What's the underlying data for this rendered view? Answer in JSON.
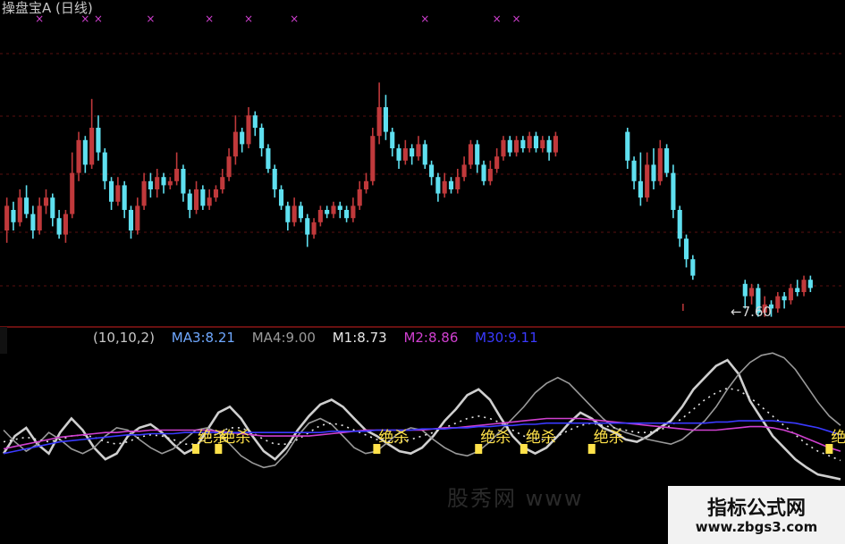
{
  "title": "操盘宝A (日线)",
  "legend": [
    {
      "text": "(10,10,2)",
      "color": "#c8c8c8"
    },
    {
      "text": "MA3:8.21",
      "color": "#6fa8ff"
    },
    {
      "text": "MA4:9.00",
      "color": "#9a9a9a"
    },
    {
      "text": "M1:8.73",
      "color": "#e6e6e6"
    },
    {
      "text": "M2:8.86",
      "color": "#d040d0"
    },
    {
      "text": "M30:9.11",
      "color": "#3a3aff"
    }
  ],
  "price_label": "←7.60",
  "signal_label": "绝杀",
  "ghost_text": "股秀网   www",
  "watermark": {
    "title": "指标公式网",
    "url": "www.zbgs3.com"
  },
  "colors": {
    "up": "#c0393b",
    "down": "#5fe0f0",
    "grid": "#5a1010",
    "signal": "#ffe24a",
    "marker": "#d040d0"
  },
  "chart_data": [
    {
      "type": "candlestick",
      "title": "操盘宝A (日线)",
      "ylim": [
        7.0,
        13.5
      ],
      "annotations": [
        {
          "text": "←7.60",
          "y": 7.6
        }
      ],
      "candles": [
        [
          9.0,
          9.6,
          8.7,
          9.8
        ],
        [
          9.5,
          9.2,
          9.0,
          9.7
        ],
        [
          9.2,
          9.8,
          9.1,
          10.0
        ],
        [
          9.8,
          9.4,
          9.3,
          10.1
        ],
        [
          9.4,
          9.0,
          8.8,
          9.6
        ],
        [
          9.0,
          9.6,
          8.9,
          9.8
        ],
        [
          9.6,
          9.8,
          9.4,
          10.0
        ],
        [
          9.8,
          9.3,
          9.1,
          9.9
        ],
        [
          9.3,
          8.9,
          8.8,
          9.5
        ],
        [
          8.9,
          9.4,
          8.7,
          9.5
        ],
        [
          9.4,
          10.4,
          9.3,
          10.9
        ],
        [
          10.4,
          11.2,
          10.2,
          11.4
        ],
        [
          11.2,
          10.6,
          10.4,
          11.3
        ],
        [
          10.6,
          11.5,
          10.5,
          12.2
        ],
        [
          11.5,
          10.9,
          10.7,
          11.8
        ],
        [
          10.9,
          10.2,
          10.0,
          11.0
        ],
        [
          10.2,
          9.7,
          9.5,
          10.3
        ],
        [
          9.7,
          10.1,
          9.6,
          10.3
        ],
        [
          10.1,
          9.5,
          9.3,
          10.2
        ],
        [
          9.5,
          9.0,
          8.8,
          9.6
        ],
        [
          9.0,
          9.6,
          8.9,
          9.8
        ],
        [
          9.6,
          10.2,
          9.5,
          10.4
        ],
        [
          10.2,
          10.0,
          9.8,
          10.4
        ],
        [
          10.0,
          10.3,
          9.8,
          10.5
        ],
        [
          10.3,
          10.1,
          9.9,
          10.4
        ],
        [
          10.1,
          10.2,
          10.0,
          10.3
        ],
        [
          10.2,
          10.5,
          10.1,
          10.9
        ],
        [
          10.5,
          9.9,
          9.7,
          10.6
        ],
        [
          9.9,
          9.5,
          9.3,
          10.0
        ],
        [
          9.5,
          10.0,
          9.4,
          10.2
        ],
        [
          10.0,
          9.6,
          9.5,
          10.1
        ],
        [
          9.6,
          9.8,
          9.5,
          10.0
        ],
        [
          9.8,
          10.0,
          9.7,
          10.1
        ],
        [
          10.0,
          10.3,
          9.9,
          10.5
        ],
        [
          10.3,
          10.8,
          10.2,
          11.0
        ],
        [
          10.8,
          11.4,
          10.6,
          11.8
        ],
        [
          11.4,
          11.1,
          10.9,
          11.5
        ],
        [
          11.1,
          11.8,
          11.0,
          12.0
        ],
        [
          11.8,
          11.5,
          11.3,
          11.9
        ],
        [
          11.5,
          11.0,
          10.8,
          11.6
        ],
        [
          11.0,
          10.5,
          10.4,
          11.1
        ],
        [
          10.5,
          10.0,
          9.8,
          10.6
        ],
        [
          10.0,
          9.6,
          9.5,
          10.1
        ],
        [
          9.6,
          9.2,
          9.0,
          9.7
        ],
        [
          9.2,
          9.6,
          9.1,
          9.8
        ],
        [
          9.6,
          9.3,
          9.2,
          9.7
        ],
        [
          9.3,
          8.9,
          8.6,
          9.4
        ],
        [
          8.9,
          9.2,
          8.8,
          9.3
        ],
        [
          9.2,
          9.5,
          9.1,
          9.6
        ],
        [
          9.5,
          9.4,
          9.3,
          9.6
        ],
        [
          9.4,
          9.6,
          9.3,
          9.7
        ],
        [
          9.6,
          9.5,
          9.3,
          9.7
        ],
        [
          9.5,
          9.3,
          9.2,
          9.6
        ],
        [
          9.3,
          9.6,
          9.2,
          9.8
        ],
        [
          9.6,
          10.0,
          9.5,
          10.2
        ],
        [
          10.0,
          10.2,
          9.9,
          10.4
        ],
        [
          10.2,
          11.3,
          10.1,
          11.5
        ],
        [
          11.3,
          12.0,
          11.1,
          12.6
        ],
        [
          12.0,
          11.4,
          11.2,
          12.3
        ],
        [
          11.4,
          11.0,
          10.8,
          11.5
        ],
        [
          11.0,
          10.7,
          10.5,
          11.1
        ],
        [
          10.7,
          11.0,
          10.6,
          11.2
        ],
        [
          11.0,
          10.8,
          10.6,
          11.1
        ],
        [
          10.8,
          11.1,
          10.7,
          11.3
        ],
        [
          11.1,
          10.6,
          10.5,
          11.2
        ],
        [
          10.6,
          10.3,
          10.1,
          10.7
        ],
        [
          10.3,
          9.9,
          9.7,
          10.4
        ],
        [
          9.9,
          10.2,
          9.8,
          10.4
        ],
        [
          10.2,
          10.0,
          9.9,
          10.3
        ],
        [
          10.0,
          10.3,
          9.9,
          10.5
        ],
        [
          10.3,
          10.6,
          10.2,
          10.8
        ],
        [
          10.6,
          11.1,
          10.5,
          11.2
        ],
        [
          11.1,
          10.6,
          10.4,
          11.2
        ],
        [
          10.6,
          10.2,
          10.1,
          10.7
        ],
        [
          10.2,
          10.5,
          10.1,
          10.7
        ],
        [
          10.5,
          10.8,
          10.4,
          11.0
        ],
        [
          10.8,
          11.2,
          10.7,
          11.3
        ],
        [
          11.2,
          10.9,
          10.8,
          11.3
        ],
        [
          10.9,
          11.2,
          10.8,
          11.3
        ],
        [
          11.2,
          11.0,
          10.9,
          11.3
        ],
        [
          11.0,
          11.3,
          10.9,
          11.4
        ],
        [
          11.3,
          11.0,
          10.9,
          11.4
        ],
        [
          11.0,
          11.2,
          10.9,
          11.3
        ],
        [
          11.2,
          10.9,
          10.7,
          11.3
        ],
        [
          10.9,
          11.3,
          10.8,
          11.4
        ],
        [
          null,
          null,
          null,
          null
        ],
        [
          null,
          null,
          null,
          null
        ],
        [
          null,
          null,
          null,
          null
        ],
        [
          null,
          null,
          null,
          null
        ],
        [
          null,
          null,
          null,
          null
        ],
        [
          null,
          null,
          null,
          null
        ],
        [
          null,
          null,
          null,
          null
        ],
        [
          null,
          null,
          null,
          null
        ],
        [
          null,
          null,
          null,
          null
        ],
        [
          null,
          null,
          null,
          null
        ],
        [
          11.4,
          10.7,
          10.5,
          11.5
        ],
        [
          10.7,
          10.2,
          10.0,
          10.8
        ],
        [
          10.2,
          9.8,
          9.6,
          10.9
        ],
        [
          9.8,
          10.6,
          9.7,
          10.9
        ],
        [
          10.6,
          10.2,
          10.0,
          11.0
        ],
        [
          10.2,
          11.0,
          10.1,
          11.2
        ],
        [
          11.0,
          10.4,
          10.3,
          11.1
        ],
        [
          10.4,
          9.5,
          9.3,
          10.6
        ],
        [
          9.5,
          8.8,
          8.6,
          9.6
        ],
        [
          8.8,
          8.3,
          8.1,
          8.9
        ],
        [
          8.3,
          7.9,
          7.8,
          8.4
        ],
        [
          null,
          null,
          null,
          null
        ],
        [
          null,
          null,
          null,
          null
        ],
        [
          null,
          null,
          null,
          null
        ],
        [
          null,
          null,
          null,
          null
        ],
        [
          null,
          null,
          null,
          null
        ],
        [
          null,
          null,
          null,
          null
        ],
        [
          null,
          null,
          null,
          null
        ],
        [
          7.7,
          7.4,
          7.1,
          7.8
        ],
        [
          7.4,
          7.6,
          7.2,
          7.7
        ],
        [
          7.6,
          7.0,
          6.9,
          7.7
        ],
        [
          7.0,
          7.2,
          6.9,
          7.4
        ],
        [
          7.2,
          7.1,
          6.9,
          7.3
        ],
        [
          7.1,
          7.4,
          7.0,
          7.5
        ],
        [
          7.4,
          7.3,
          7.1,
          7.5
        ],
        [
          7.3,
          7.6,
          7.2,
          7.7
        ],
        [
          7.6,
          7.5,
          7.4,
          7.8
        ],
        [
          7.5,
          7.8,
          7.4,
          7.9
        ],
        [
          7.8,
          7.6,
          7.5,
          7.9
        ]
      ],
      "top_markers": [
        5,
        12,
        14,
        22,
        31,
        37,
        44,
        64,
        75,
        78
      ]
    },
    {
      "type": "line",
      "ylim": [
        0,
        100
      ],
      "legend": [
        "(10,10,2)",
        "MA3:8.21",
        "MA4:9.00",
        "M1:8.73",
        "M2:8.86",
        "M30:9.11"
      ],
      "series": [
        {
          "name": "MA3",
          "color": "#cfcfcf",
          "values": [
            40,
            55,
            62,
            48,
            40,
            58,
            70,
            60,
            45,
            35,
            40,
            55,
            62,
            65,
            58,
            48,
            40,
            45,
            60,
            75,
            80,
            70,
            55,
            42,
            35,
            45,
            60,
            72,
            82,
            86,
            80,
            70,
            60,
            55,
            48,
            42,
            40,
            45,
            55,
            68,
            78,
            90,
            95,
            86,
            70,
            55,
            45,
            40,
            45,
            55,
            66,
            75,
            70,
            62,
            58,
            52,
            50,
            55,
            62,
            68,
            80,
            95,
            105,
            115,
            120,
            108,
            85,
            70,
            55,
            45,
            35,
            28,
            22,
            20,
            18
          ]
        },
        {
          "name": "MA4",
          "color": "#9a9a9a",
          "values": [
            60,
            50,
            42,
            48,
            58,
            52,
            44,
            40,
            45,
            55,
            62,
            60,
            52,
            45,
            40,
            44,
            52,
            60,
            62,
            58,
            48,
            38,
            32,
            28,
            30,
            40,
            55,
            66,
            70,
            65,
            55,
            45,
            40,
            42,
            50,
            58,
            62,
            60,
            52,
            45,
            40,
            38,
            42,
            50,
            60,
            70,
            80,
            92,
            100,
            105,
            100,
            90,
            80,
            70,
            62,
            58,
            55,
            52,
            50,
            48,
            52,
            60,
            68,
            80,
            95,
            108,
            118,
            124,
            126,
            122,
            112,
            98,
            84,
            72,
            64
          ]
        },
        {
          "name": "M1",
          "color": "#e6e6e6",
          "dash": "2 5",
          "values": [
            50,
            52,
            54,
            52,
            50,
            52,
            55,
            56,
            54,
            50,
            48,
            50,
            54,
            56,
            55,
            52,
            48,
            48,
            52,
            58,
            62,
            62,
            58,
            52,
            48,
            48,
            52,
            58,
            64,
            66,
            64,
            60,
            56,
            52,
            50,
            50,
            52,
            55,
            58,
            62,
            66,
            70,
            72,
            70,
            66,
            60,
            55,
            52,
            52,
            55,
            60,
            64,
            66,
            64,
            62,
            60,
            58,
            58,
            60,
            64,
            70,
            78,
            86,
            92,
            96,
            94,
            88,
            80,
            72,
            64,
            56,
            48,
            42,
            38,
            34
          ]
        },
        {
          "name": "M2",
          "color": "#d040d0",
          "values": [
            44,
            46,
            48,
            50,
            52,
            54,
            55,
            56,
            57,
            58,
            58,
            59,
            59,
            60,
            60,
            60,
            60,
            60,
            60,
            59,
            58,
            57,
            56,
            55,
            55,
            55,
            55,
            55,
            56,
            57,
            58,
            59,
            60,
            60,
            60,
            60,
            60,
            60,
            61,
            62,
            62,
            63,
            64,
            65,
            66,
            67,
            68,
            69,
            70,
            70,
            70,
            70,
            69,
            68,
            67,
            66,
            65,
            64,
            63,
            62,
            61,
            60,
            60,
            60,
            61,
            62,
            63,
            63,
            62,
            60,
            57,
            53,
            49,
            45,
            42
          ]
        },
        {
          "name": "M30",
          "color": "#3a3aff",
          "values": [
            40,
            42,
            44,
            46,
            48,
            50,
            51,
            52,
            53,
            54,
            55,
            56,
            56,
            57,
            57,
            57,
            58,
            58,
            58,
            58,
            58,
            58,
            58,
            58,
            58,
            58,
            58,
            58,
            58,
            59,
            59,
            59,
            59,
            60,
            60,
            60,
            60,
            61,
            61,
            61,
            62,
            62,
            63,
            63,
            64,
            64,
            65,
            65,
            66,
            66,
            66,
            66,
            66,
            66,
            66,
            66,
            66,
            66,
            66,
            66,
            66,
            66,
            66,
            67,
            67,
            68,
            68,
            68,
            68,
            67,
            66,
            64,
            62,
            59,
            56
          ]
        }
      ],
      "signals": [
        {
          "x": 17,
          "label": "绝杀"
        },
        {
          "x": 19,
          "label": "绝杀"
        },
        {
          "x": 33,
          "label": "绝杀"
        },
        {
          "x": 42,
          "label": "绝杀"
        },
        {
          "x": 46,
          "label": "绝杀"
        },
        {
          "x": 52,
          "label": "绝杀"
        },
        {
          "x": 73,
          "label": "绝杀"
        }
      ]
    }
  ]
}
